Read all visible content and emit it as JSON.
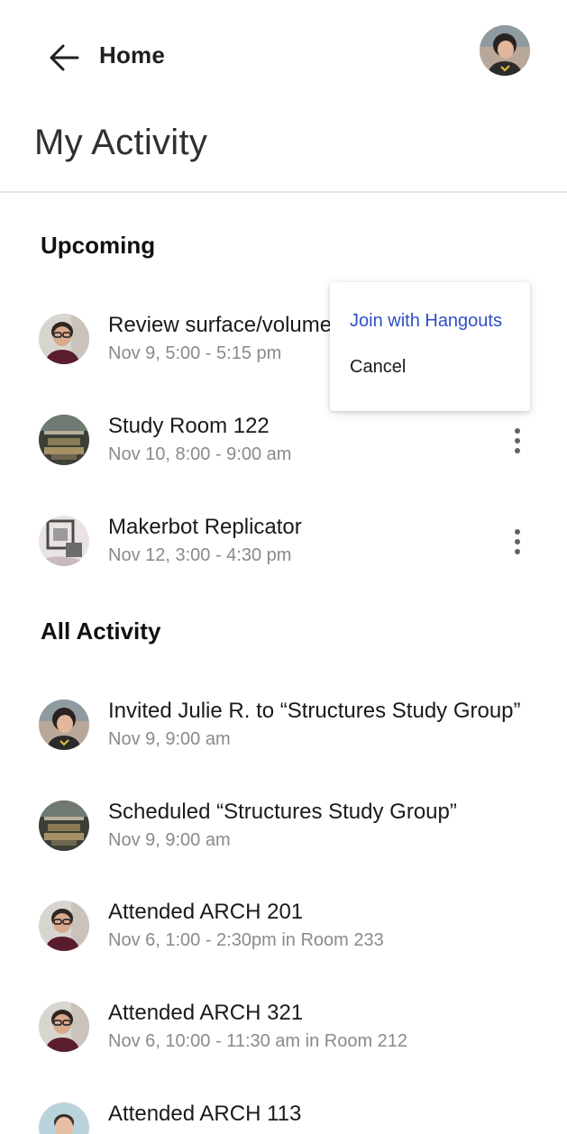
{
  "header": {
    "back_label": "Home"
  },
  "page": {
    "title": "My Activity"
  },
  "sections": {
    "upcoming": "Upcoming",
    "all_activity": "All Activity"
  },
  "upcoming": [
    {
      "title": "Review surface/volume",
      "subtitle": "Nov 9, 5:00 - 5:15 pm",
      "avatar": "person-glasses"
    },
    {
      "title": "Study Room 122",
      "subtitle": "Nov 10, 8:00 - 9:00 am",
      "avatar": "study-room"
    },
    {
      "title": "Makerbot Replicator",
      "subtitle": "Nov 12, 3:00 - 4:30 pm",
      "avatar": "3d-printer"
    }
  ],
  "all_activity": [
    {
      "title": "Invited Julie R. to “Structures Study Group”",
      "subtitle": "Nov 9, 9:00 am",
      "avatar": "person-woman"
    },
    {
      "title": "Scheduled “Structures Study Group”",
      "subtitle": "Nov 9, 9:00 am",
      "avatar": "study-room"
    },
    {
      "title": "Attended ARCH 201",
      "subtitle": "Nov 6, 1:00 - 2:30pm in Room 233",
      "avatar": "person-glasses"
    },
    {
      "title": "Attended ARCH 321",
      "subtitle": "Nov 6, 10:00 - 11:30 am in Room 212",
      "avatar": "person-glasses"
    },
    {
      "title": "Attended ARCH 113",
      "subtitle": "",
      "avatar": "person-man"
    }
  ],
  "menu": {
    "join": "Join with Hangouts",
    "cancel": "Cancel"
  },
  "icons": {
    "back": "arrow-left-icon",
    "more": "more-vert-icon"
  },
  "colors": {
    "accent": "#2e4fc4",
    "subtitle": "#8a8a8a",
    "divider": "#e6e6e6"
  }
}
